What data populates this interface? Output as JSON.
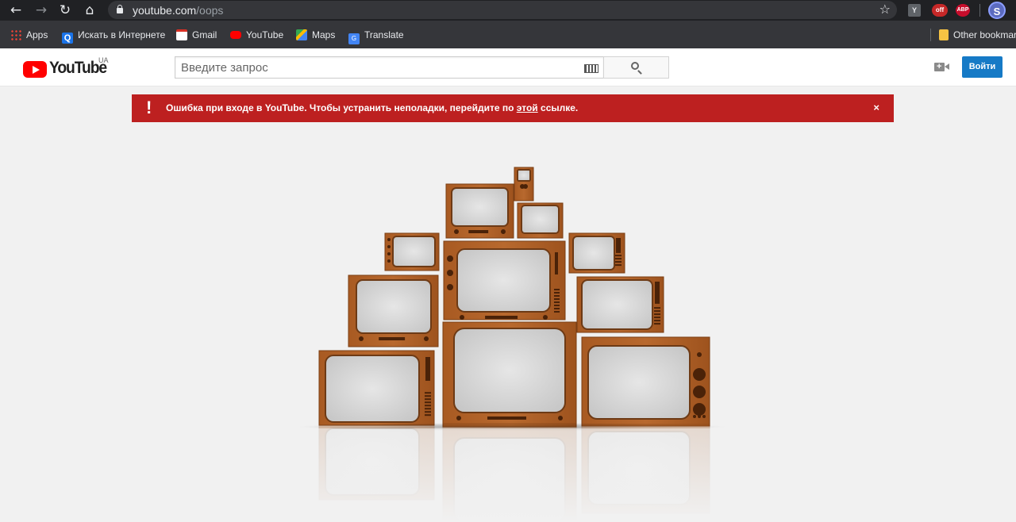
{
  "browser": {
    "url_host": "youtube.com",
    "url_path": "/oops",
    "extensions": [
      "Y",
      "off",
      "ABP"
    ],
    "profile_initial": "S"
  },
  "bookmarks": {
    "items": [
      {
        "label": "Apps",
        "icon": "apps-grid-icon"
      },
      {
        "label": "Искать в Интернете",
        "icon": "search-q-icon"
      },
      {
        "label": "Gmail",
        "icon": "gmail-icon"
      },
      {
        "label": "YouTube",
        "icon": "youtube-icon"
      },
      {
        "label": "Maps",
        "icon": "maps-icon"
      },
      {
        "label": "Translate",
        "icon": "translate-icon"
      }
    ],
    "other": "Other bookmarks"
  },
  "header": {
    "logo_text": "YouTube",
    "region": "UA",
    "search_placeholder": "Введите запрос",
    "signin_label": "Войти"
  },
  "alert": {
    "bang": "!",
    "text_before": "Ошибка при входе в YouTube. Чтобы устранить неполадки, перейдите по ",
    "link_text": "этой",
    "text_after": " ссылке.",
    "close": "×"
  },
  "colors": {
    "alert_bg": "#bd2020",
    "brand_red": "#ff0000",
    "signin_blue": "#167ac6",
    "tv_wood": "#b0622a"
  }
}
